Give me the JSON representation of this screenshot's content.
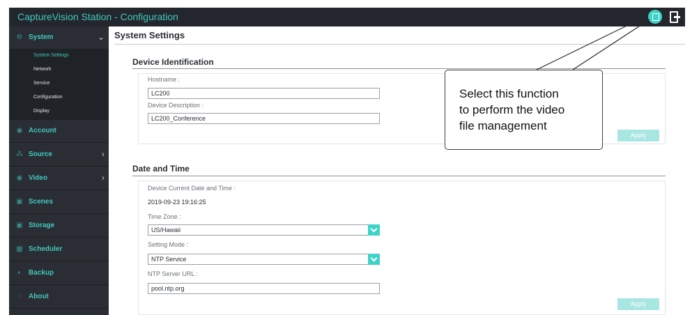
{
  "app": {
    "title": "CaptureVision Station - Configuration"
  },
  "header": {
    "file_icon": "file-management-icon",
    "logout_icon": "logout-icon"
  },
  "colors": {
    "accent": "#41c8c0",
    "sidebar_bg": "#2a2d33",
    "button_disabled": "#a8e6e1"
  },
  "sidebar": {
    "groups": [
      {
        "label": "System",
        "icon": "gear-icon",
        "chevron": "⌄"
      },
      {
        "label": "Account",
        "icon": "account-icon"
      },
      {
        "label": "Source",
        "icon": "source-icon",
        "chevron": "›"
      },
      {
        "label": "Video",
        "icon": "video-icon",
        "chevron": "›"
      },
      {
        "label": "Scenes",
        "icon": "scenes-icon"
      },
      {
        "label": "Storage",
        "icon": "storage-icon"
      },
      {
        "label": "Scheduler",
        "icon": "scheduler-icon"
      },
      {
        "label": "Backup",
        "icon": "backup-icon"
      },
      {
        "label": "About",
        "icon": "about-icon"
      }
    ],
    "system_items": [
      "System Settings",
      "Network",
      "Service",
      "Configuration",
      "Display"
    ]
  },
  "main": {
    "title": "System Settings",
    "device_identification": {
      "title": "Device Identification",
      "hostname_label": "Hostname :",
      "hostname_value": "LC200",
      "description_label": "Device Description :",
      "description_value": "LC200_Conference",
      "apply_label": "Apply"
    },
    "date_time": {
      "title": "Date and Time",
      "current_label": "Device Current Date and Time :",
      "current_value": "2019-09-23 19:16:25",
      "timezone_label": "Time Zone :",
      "timezone_value": "US/Hawaii",
      "mode_label": "Setting Mode :",
      "mode_value": "NTP Service",
      "ntp_label": "NTP Server URL :",
      "ntp_value": "pool.ntp.org",
      "apply_label": "Apply"
    }
  },
  "callout": {
    "text": "Select this function\nto perform the video\nfile management"
  }
}
